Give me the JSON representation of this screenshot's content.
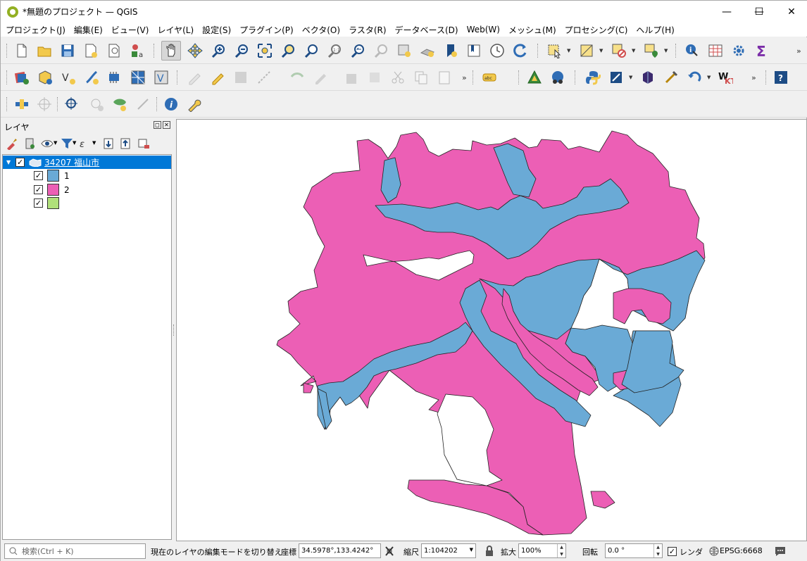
{
  "window": {
    "title": "*無題のプロジェクト — QGIS",
    "minimize": "—",
    "maximize": "☐",
    "close": "✕"
  },
  "menu": [
    "プロジェクト(J)",
    "編集(E)",
    "ビュー(V)",
    "レイヤ(L)",
    "設定(S)",
    "プラグイン(P)",
    "ベクタ(O)",
    "ラスタ(R)",
    "データベース(D)",
    "Web(W)",
    "メッシュ(M)",
    "プロセシング(C)",
    "ヘルプ(H)"
  ],
  "layers_panel": {
    "title": "レイヤ",
    "layer": {
      "name": "34207 福山市",
      "checked": true,
      "categories": [
        {
          "label": "1",
          "color": "#6aaad6",
          "checked": true
        },
        {
          "label": "2",
          "color": "#ec5fb5",
          "checked": true
        },
        {
          "label": "",
          "color": "#b0e07a",
          "checked": true
        }
      ]
    }
  },
  "map": {
    "fill_colors": {
      "category_1": "#6aaad6",
      "category_2": "#ec5fb5"
    }
  },
  "statusbar": {
    "search_placeholder": "検索(Ctrl + K)",
    "message": "現在のレイヤの編集モードを切り替え",
    "coord_label": "座標",
    "coord_value": "34.5978°,133.4242°",
    "scale_label": "縮尺",
    "scale_value": "1:104202",
    "magnifier_label": "拡大",
    "magnifier_value": "100%",
    "rotation_label": "回転",
    "rotation_value": "0.0 °",
    "render_label": "レンダ",
    "render_checked": true,
    "crs": "EPSG:6668"
  }
}
